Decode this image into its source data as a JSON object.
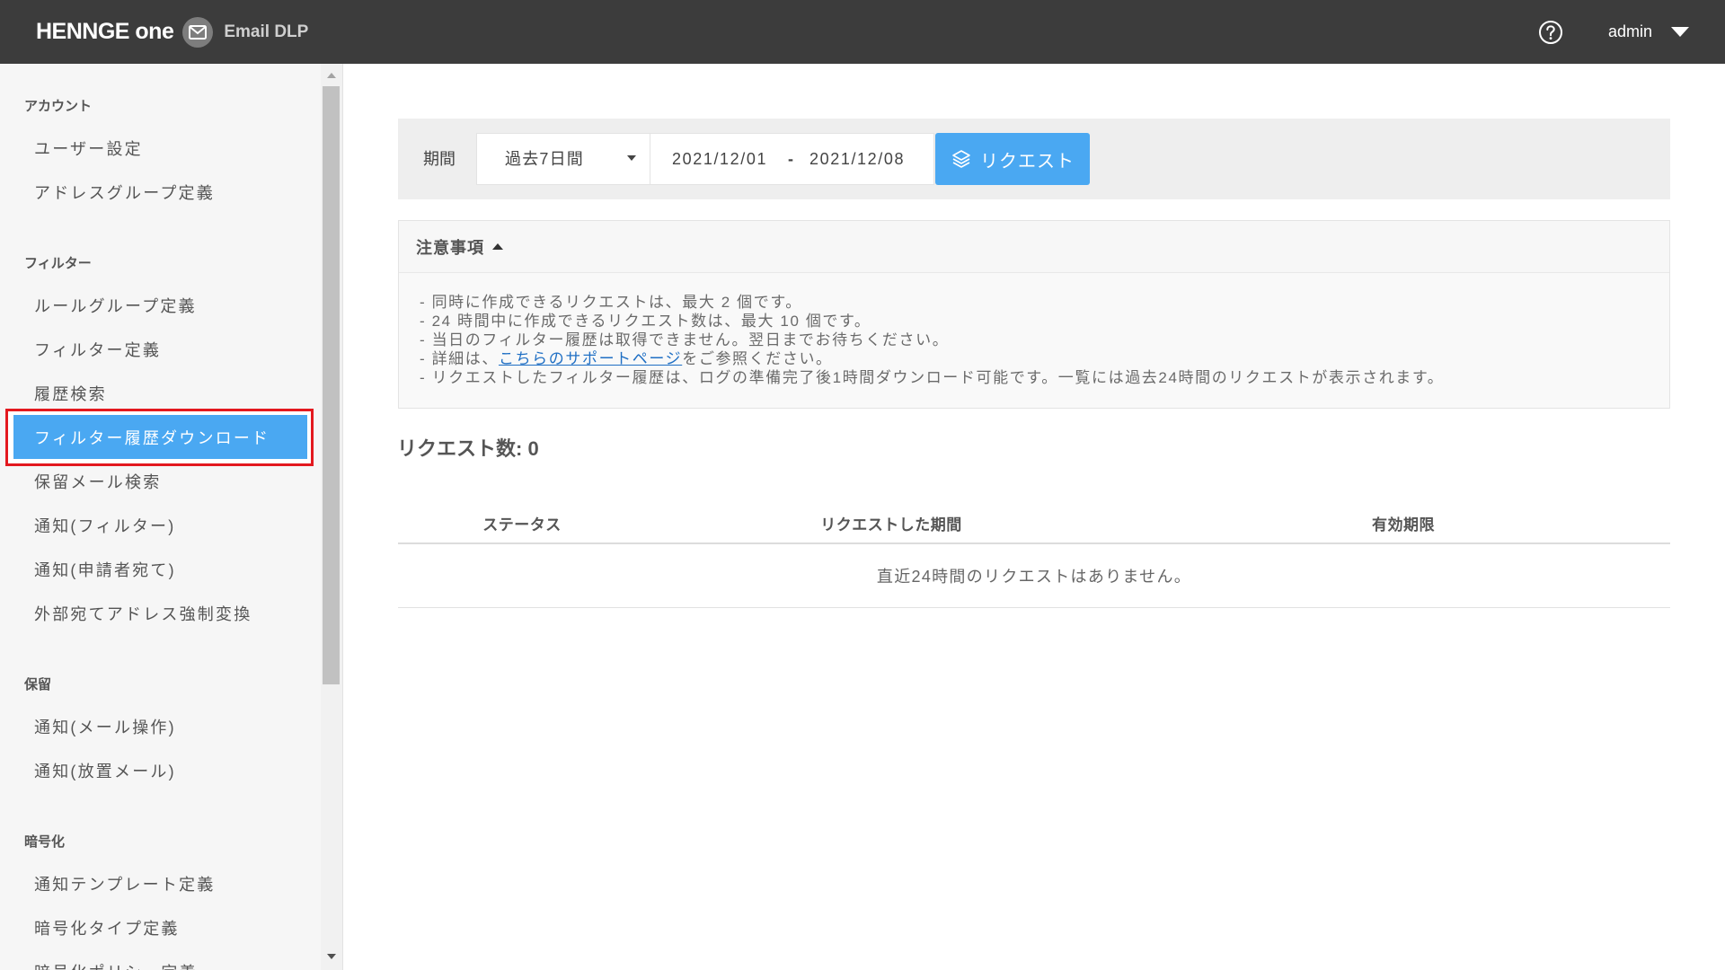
{
  "colors": {
    "header_bg": "#3c3c3c",
    "accent": "#4aa8f2",
    "highlight_border": "#e3191f",
    "link": "#1f6fc4"
  },
  "header": {
    "brand": "HENNGE one",
    "product": "Email DLP",
    "user": "admin",
    "icons": {
      "logo": "mail-icon",
      "help": "help-icon",
      "user_menu": "caret-down-icon"
    }
  },
  "sidebar": {
    "sections": [
      {
        "title": "アカウント",
        "items": [
          {
            "label": "ユーザー設定"
          },
          {
            "label": "アドレスグループ定義"
          }
        ]
      },
      {
        "title": "フィルター",
        "items": [
          {
            "label": "ルールグループ定義"
          },
          {
            "label": "フィルター定義"
          },
          {
            "label": "履歴検索"
          },
          {
            "label": "フィルター履歴ダウンロード",
            "active": true,
            "highlighted": true
          },
          {
            "label": "保留メール検索"
          },
          {
            "label": "通知(フィルター)"
          },
          {
            "label": "通知(申請者宛て)"
          },
          {
            "label": "外部宛てアドレス強制変換"
          }
        ]
      },
      {
        "title": "保留",
        "items": [
          {
            "label": "通知(メール操作)"
          },
          {
            "label": "通知(放置メール)"
          }
        ]
      },
      {
        "title": "暗号化",
        "items": [
          {
            "label": "通知テンプレート定義"
          },
          {
            "label": "暗号化タイプ定義"
          },
          {
            "label": "暗号化ポリシー定義"
          }
        ]
      }
    ]
  },
  "filter": {
    "period_label": "期間",
    "period_select": "過去7日間",
    "date_from": "2021/12/01",
    "date_separator": "-",
    "date_to": "2021/12/08",
    "request_button": "リクエスト",
    "request_button_icon": "layers-icon"
  },
  "notice": {
    "title": "注意事項",
    "expanded": true,
    "lines": [
      {
        "text": "- 同時に作成できるリクエストは、最大 2 個です。"
      },
      {
        "text": "- 24 時間中に作成できるリクエスト数は、最大 10 個です。"
      },
      {
        "text": "- 当日のフィルター履歴は取得できません。翌日までお待ちください。"
      },
      {
        "before": "- 詳細は、",
        "link": "こちらのサポートページ",
        "after": "をご参照ください。"
      },
      {
        "text": "- リクエストしたフィルター履歴は、ログの準備完了後1時間ダウンロード可能です。一覧には過去24時間のリクエストが表示されます。"
      }
    ]
  },
  "requests": {
    "count_label": "リクエスト数:",
    "count": 0
  },
  "table": {
    "columns": [
      "ステータス",
      "リクエストした期間",
      "有効期限"
    ],
    "rows": [],
    "empty_message": "直近24時間のリクエストはありません。"
  }
}
